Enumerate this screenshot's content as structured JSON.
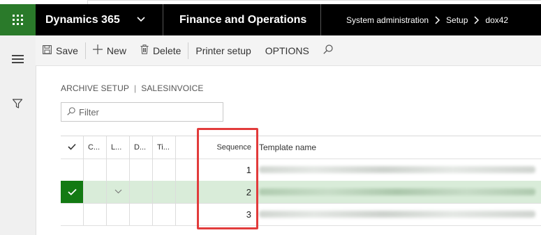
{
  "navbar": {
    "app_title": "Dynamics 365",
    "module_title": "Finance and Operations",
    "breadcrumbs": [
      "System administration",
      "Setup",
      "dox42"
    ]
  },
  "actions": {
    "save": "Save",
    "new": "New",
    "delete": "Delete",
    "printer_setup": "Printer setup",
    "options": "OPTIONS"
  },
  "caption": {
    "left": "ARCHIVE SETUP",
    "sep": "|",
    "right": "SALESINVOICE"
  },
  "filter": {
    "placeholder": "Filter"
  },
  "grid": {
    "columns": [
      "C...",
      "L...",
      "D...",
      "Ti...",
      "Sequence",
      "Template name"
    ],
    "rows": [
      {
        "sequence": "1",
        "selected": false
      },
      {
        "sequence": "2",
        "selected": true
      },
      {
        "sequence": "3",
        "selected": false
      }
    ]
  },
  "colors": {
    "navbar": "#000000",
    "waffle": "#2a7a2a",
    "selected_row": "#d9ecd9",
    "selected_check": "#137a13",
    "highlight": "#e23b3b"
  },
  "icons": [
    "waffle-icon",
    "chevron-down-icon",
    "chevron-right-icon",
    "hamburger-icon",
    "filter-icon",
    "save-icon",
    "plus-icon",
    "delete-icon",
    "search-icon",
    "checkmark-icon"
  ]
}
